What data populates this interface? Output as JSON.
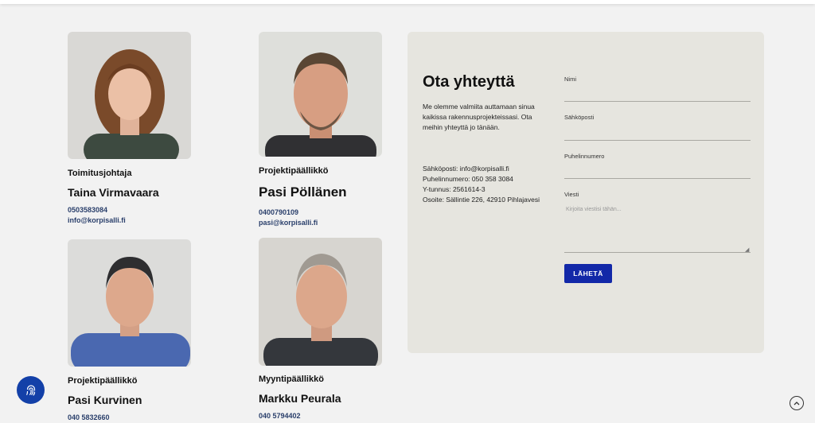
{
  "team": [
    {
      "role": "Toimitusjohtaja",
      "name": "Taina Virmavaara",
      "phone": "0503583084",
      "email": "info@korpisalli.fi",
      "photo": "portrait-woman-curly-hair"
    },
    {
      "role": "Projektipäällikkö",
      "name": "Pasi Pöllänen",
      "phone": "0400790109",
      "email": "pasi@korpisalli.fi",
      "photo": "portrait-man-beard"
    },
    {
      "role": "Projektipäällikkö",
      "name": "Pasi Kurvinen",
      "phone": "040 5832660",
      "photo": "portrait-man-blue-shirt"
    },
    {
      "role": "Myyntipäällikkö",
      "name": "Markku Peurala",
      "phone": "040 5794402",
      "photo": "portrait-man-grey-hair"
    }
  ],
  "contact": {
    "title": "Ota yhteyttä",
    "intro": "Me olemme valmiita auttamaan sinua kaikissa rakennusprojekteissasi. Ota meihin yhteyttä jo tänään.",
    "email_line": "Sähköposti: info@korpisalli.fi",
    "phone_line": "Puhelinnumero: 050 358 3084",
    "ytunnus_line": "Y-tunnus: 2561614-3",
    "address_line": "Osoite: Sällintie 226, 42910 Pihlajavesi"
  },
  "form": {
    "name_label": "Nimi",
    "email_label": "Sähköposti",
    "phone_label": "Puhelinnumero",
    "message_label": "Viesti",
    "message_placeholder": "Kirjoita viestisi tähän...",
    "submit_label": "LÄHETÄ"
  },
  "colors": {
    "accent": "#1228a8",
    "contact_link": "#2a3f6b",
    "panel_bg": "#e6e5df",
    "fab_bg": "#1340a8"
  },
  "icons": {
    "fab": "fingerprint-icon",
    "scroll_top": "chevron-up-icon"
  }
}
